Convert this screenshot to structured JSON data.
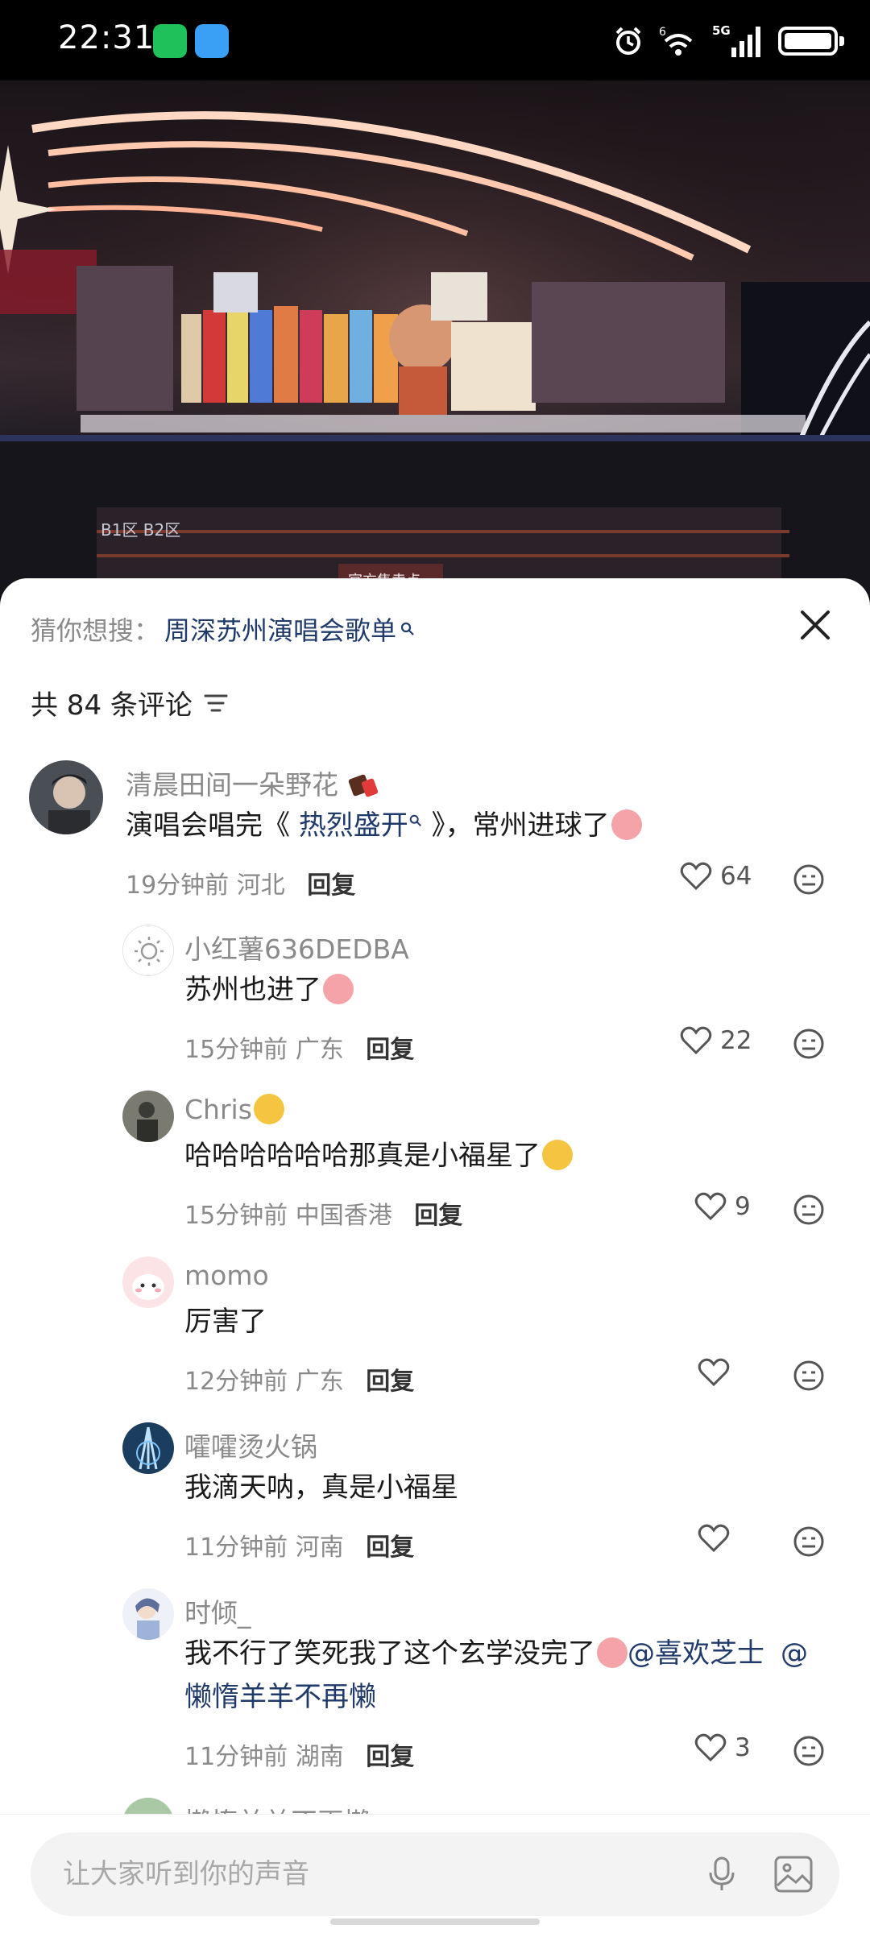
{
  "status_bar": {
    "time": "22:31",
    "network": "5G",
    "signal_prefix": "6"
  },
  "search": {
    "prefix": "猜你想搜：",
    "term": "周深苏州演唱会歌单"
  },
  "comment_count_label": "共 84 条评论",
  "comments": [
    {
      "name": "清晨田间一朵野花",
      "text_before": "演唱会唱完《 ",
      "link": "热烈盛开",
      "text_after": " 》，常州进球了",
      "time": "19分钟前",
      "location": "河北",
      "reply_label": "回复",
      "likes": "64"
    },
    {
      "name": "小红薯636DEDBA",
      "text": "苏州也进了",
      "time": "15分钟前",
      "location": "广东",
      "reply_label": "回复",
      "likes": "22"
    },
    {
      "name": "Chris",
      "text": "哈哈哈哈哈哈那真是小福星了",
      "time": "15分钟前",
      "location": "中国香港",
      "reply_label": "回复",
      "likes": "9"
    },
    {
      "name": "momo",
      "text": "厉害了",
      "time": "12分钟前",
      "location": "广东",
      "reply_label": "回复",
      "likes": ""
    },
    {
      "name": "嚯嚯烫火锅",
      "text": "我滴天呐，真是小福星",
      "time": "11分钟前",
      "location": "河南",
      "reply_label": "回复",
      "likes": ""
    },
    {
      "name": "时倾_",
      "text": "我不行了笑死我了这个玄学没完了",
      "mention1": "@喜欢芝士",
      "mention2_a": "@",
      "mention2_b": "懒惰羊羊不再懒",
      "time": "11分钟前",
      "location": "湖南",
      "reply_label": "回复",
      "likes": "3"
    },
    {
      "name": "懒惰羊羊不再懒"
    }
  ],
  "input": {
    "placeholder": "让大家听到你的声音"
  },
  "photo_signs": {
    "zone": "B1区 B2区",
    "booth": "官方售卖点"
  }
}
